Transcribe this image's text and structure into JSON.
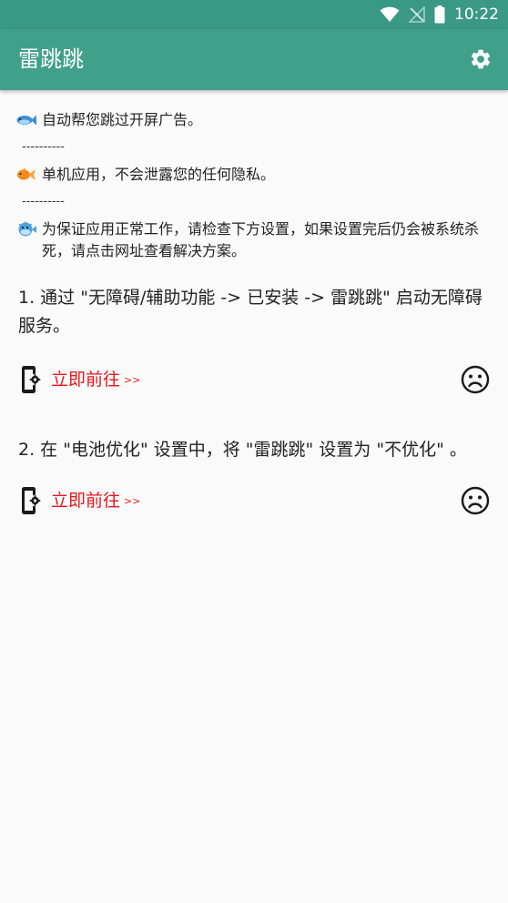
{
  "status_bar": {
    "time": "10:22",
    "icons": [
      "wifi-icon",
      "signal-off-icon",
      "battery-icon"
    ]
  },
  "app_bar": {
    "title": "雷跳跳",
    "settings_icon": "gear-icon"
  },
  "intro": {
    "lines": [
      {
        "icon": "fish-icon",
        "text": "自动帮您跳过开屏广告。"
      },
      {
        "icon": "goldfish-icon",
        "text": "单机应用，不会泄露您的任何隐私。"
      },
      {
        "icon": "blowfish-icon",
        "text": "为保证应用正常工作，请检查下方设置，如果设置完后仍会被系统杀死，请点击网址查看解决方案。"
      }
    ],
    "divider": "----------"
  },
  "steps": [
    {
      "text": "1. 通过 \"无障碍/辅助功能 -> 已安装 -> 雷跳跳\" 启动无障碍服务。",
      "link": "立即前往",
      "arrows": ">>",
      "status_icon": "sad-face-icon"
    },
    {
      "text": "2. 在 \"电池优化\" 设置中，将 \"雷跳跳\" 设置为 \"不优化\" 。",
      "link": "立即前往",
      "arrows": ">>",
      "status_icon": "sad-face-icon"
    }
  ],
  "colors": {
    "status_bar": "#3a9985",
    "app_bar": "#40a089",
    "link": "#e8161c",
    "background": "#fafafa"
  }
}
